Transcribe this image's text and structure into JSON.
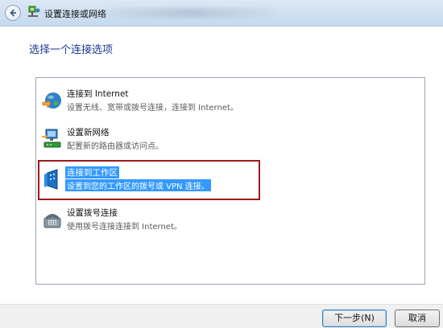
{
  "window": {
    "title": "设置连接或网络"
  },
  "heading": "选择一个连接选项",
  "options": [
    {
      "title": "连接到 Internet",
      "description": "设置无线、宽带或拨号连接，连接到 Internet。",
      "icon": "globe-icon",
      "selected": false
    },
    {
      "title": "设置新网络",
      "description": "配置新的路由器或访问点。",
      "icon": "network-setup-icon",
      "selected": false
    },
    {
      "title": "连接到工作区",
      "description": "设置到您的工作区的拨号或 VPN 连接。",
      "icon": "workplace-icon",
      "selected": true
    },
    {
      "title": "设置拨号连接",
      "description": "使用拨号连接连接到 Internet。",
      "icon": "dialup-phone-icon",
      "selected": false
    }
  ],
  "buttons": {
    "next": "下一步(N)",
    "cancel": "取消"
  },
  "colors": {
    "selection": "#3399ff",
    "heading": "#1a3a8f",
    "highlight_frame": "#9b1b1b"
  }
}
